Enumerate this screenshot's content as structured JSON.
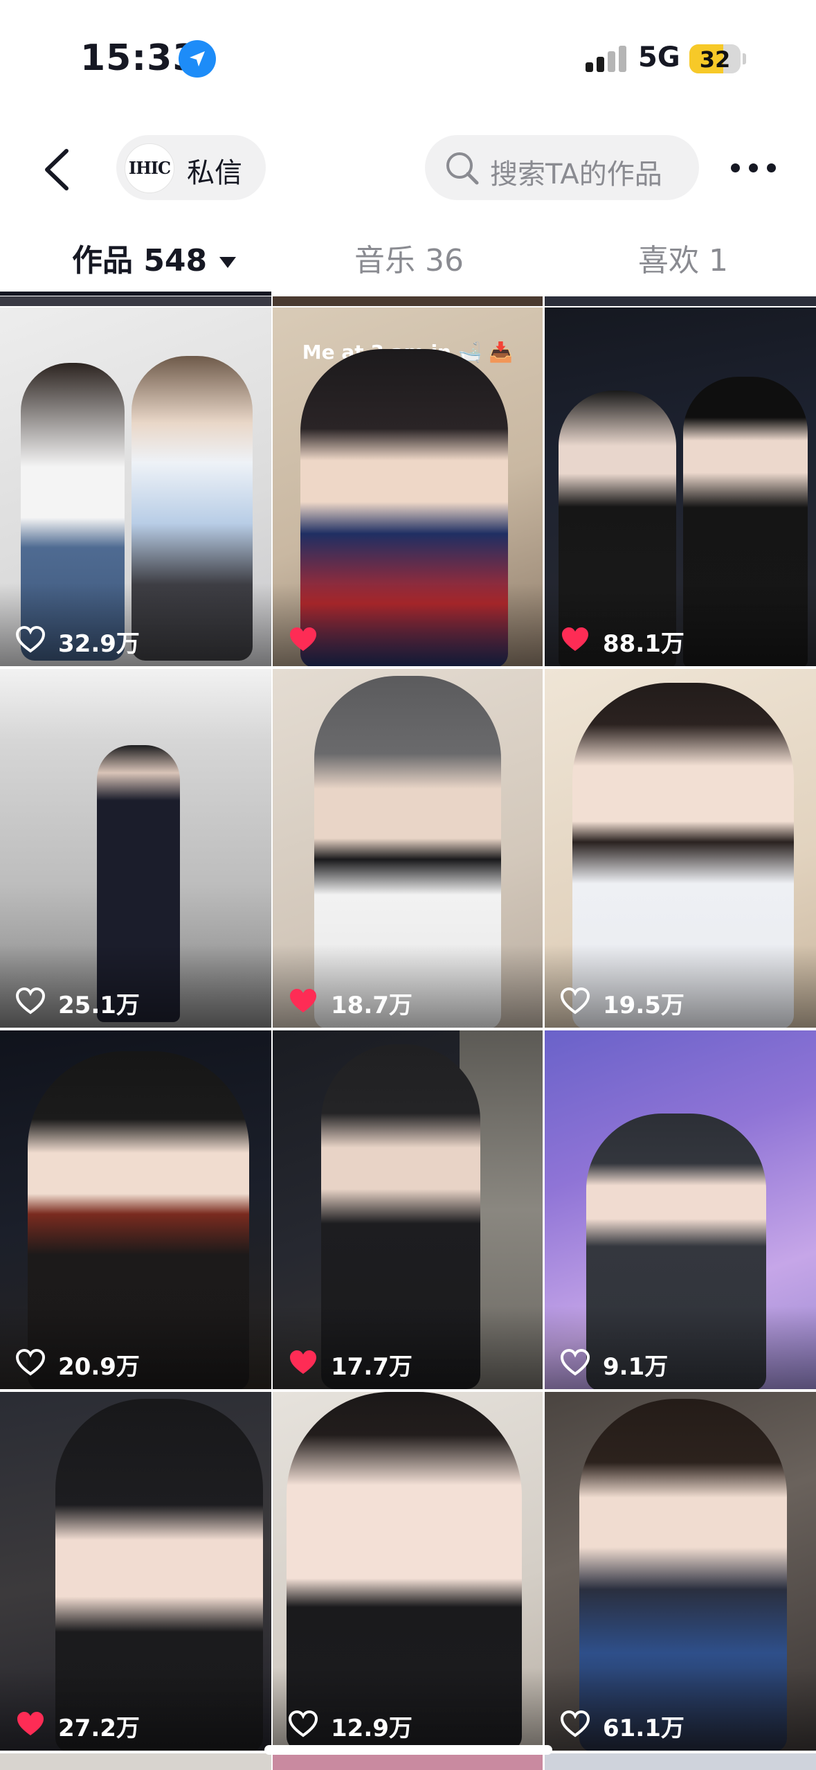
{
  "status_bar": {
    "time": "15:33",
    "network": "5G",
    "battery": "32"
  },
  "nav": {
    "avatar_text": "IHIC",
    "message_label": "私信",
    "search_placeholder": "搜索TA的作品"
  },
  "tabs": [
    {
      "label": "作品 548",
      "active": true
    },
    {
      "label": "音乐 36",
      "active": false
    },
    {
      "label": "喜欢 1",
      "active": false
    }
  ],
  "colors": {
    "liked": "#fe2c55",
    "brand_text": "#161823",
    "muted": "#8a8b91"
  },
  "grid": {
    "items": [
      {
        "likes": "32.9万",
        "liked": false,
        "caption": ""
      },
      {
        "likes": "",
        "liked": true,
        "caption": "Me at 3 am in 🛁 📥"
      },
      {
        "likes": "88.1万",
        "liked": true,
        "caption": ""
      },
      {
        "likes": "25.1万",
        "liked": false,
        "caption": ""
      },
      {
        "likes": "18.7万",
        "liked": true,
        "caption": ""
      },
      {
        "likes": "19.5万",
        "liked": false,
        "caption": ""
      },
      {
        "likes": "20.9万",
        "liked": false,
        "caption": ""
      },
      {
        "likes": "17.7万",
        "liked": true,
        "caption": ""
      },
      {
        "likes": "9.1万",
        "liked": false,
        "caption": ""
      },
      {
        "likes": "27.2万",
        "liked": true,
        "caption": ""
      },
      {
        "likes": "12.9万",
        "liked": false,
        "caption": ""
      },
      {
        "likes": "61.1万",
        "liked": false,
        "caption": ""
      }
    ]
  }
}
